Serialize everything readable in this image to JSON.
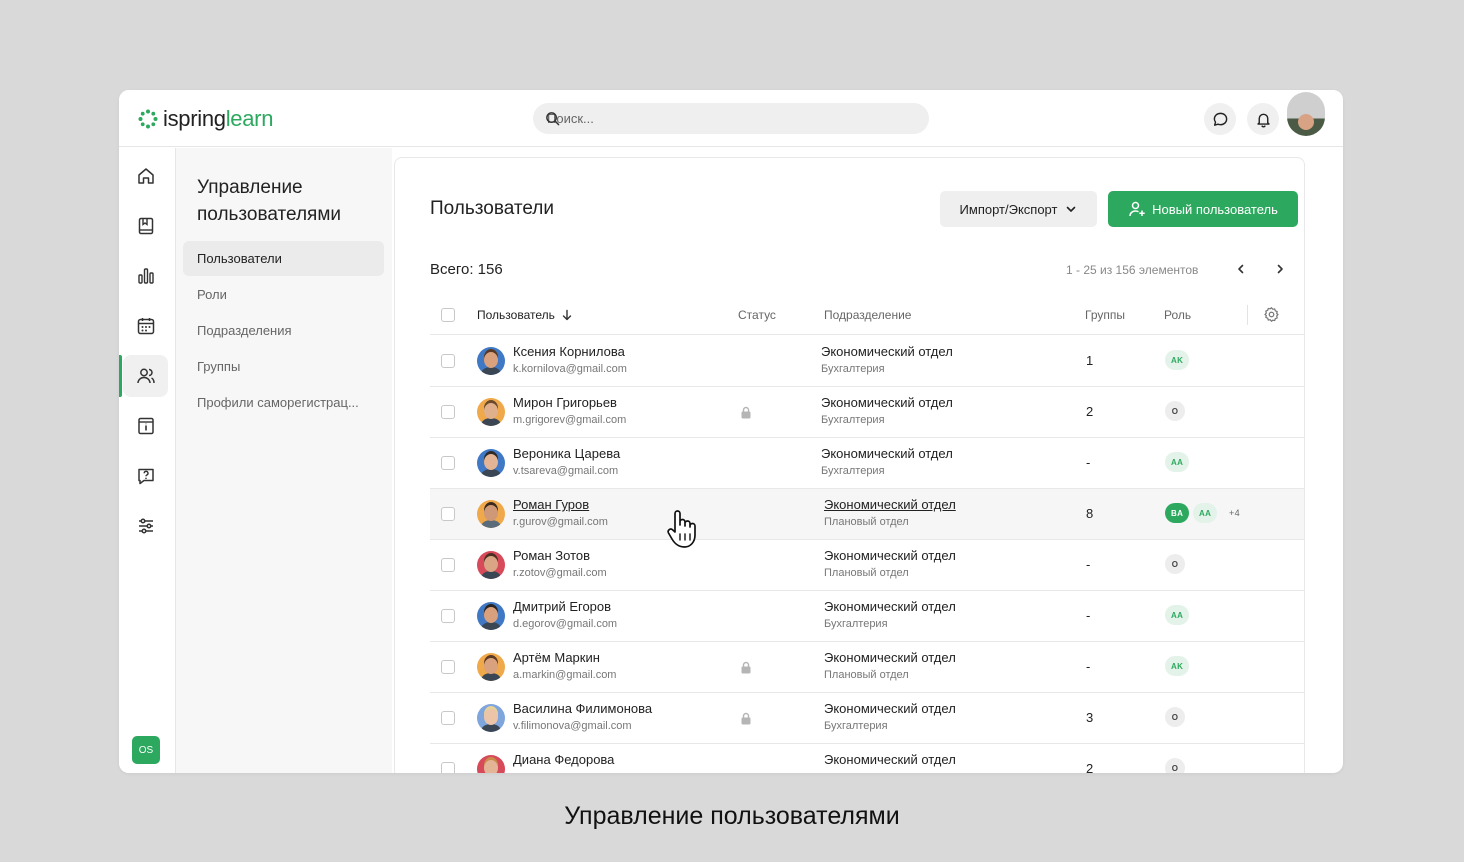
{
  "app": {
    "logo_word1": "ispring",
    "logo_word2": "learn",
    "brand_color": "#2da85f"
  },
  "search": {
    "placeholder": "Поиск..."
  },
  "topbar_icons": [
    "search-icon",
    "chat-icon",
    "bell-icon"
  ],
  "rail": {
    "items": [
      "home-icon",
      "book-icon",
      "chart-icon",
      "calendar-icon",
      "users-icon",
      "info-card-icon",
      "question-icon",
      "sliders-icon"
    ],
    "active_index": 4,
    "user_badge": "OS"
  },
  "subnav": {
    "title": "Управление пользователями",
    "items": [
      {
        "label": "Пользователи",
        "active": true
      },
      {
        "label": "Роли",
        "active": false
      },
      {
        "label": "Подразделения",
        "active": false
      },
      {
        "label": "Группы",
        "active": false
      },
      {
        "label": "Профили саморегистрац...",
        "active": false
      }
    ]
  },
  "main": {
    "title": "Пользователи",
    "import_label": "Импорт/Экспорт",
    "new_user_label": "Новый пользователь",
    "total": "Всего: 156",
    "pager": "1 - 25 из 156 элементов"
  },
  "table": {
    "columns": {
      "user": "Пользователь",
      "status": "Статус",
      "department": "Подразделение",
      "groups": "Группы",
      "role": "Роль"
    },
    "rows": [
      {
        "name": "Ксения Корнилова",
        "email": "k.kornilova@gmail.com",
        "locked": false,
        "dept": "Экономический отдел",
        "subdept": "Бухгалтерия",
        "groups": "1",
        "roles": [
          {
            "t": "AK",
            "s": "light"
          }
        ],
        "avatar_bg": "#3f78c4",
        "skin": "#d9a17e",
        "hair": "#5a3a24"
      },
      {
        "name": "Мирон Григорьев",
        "email": "m.grigorev@gmail.com",
        "locked": true,
        "dept": "Экономический отдел",
        "subdept": "Бухгалтерия",
        "groups": "2",
        "roles": [
          {
            "t": "O",
            "s": "grey"
          }
        ],
        "avatar_bg": "#f0a94a",
        "skin": "#e0b08c",
        "hair": "#6a4a2a"
      },
      {
        "name": "Вероника Царева",
        "email": "v.tsareva@gmail.com",
        "locked": false,
        "dept": "Экономический отдел",
        "subdept": "Бухгалтерия",
        "groups": "-",
        "roles": [
          {
            "t": "AA",
            "s": "light"
          }
        ],
        "avatar_bg": "#3f78c4",
        "skin": "#e3b495",
        "hair": "#2f2a26"
      },
      {
        "name": "Роман Гуров",
        "email": "r.gurov@gmail.com",
        "locked": false,
        "dept": "Экономический отдел",
        "subdept": "Плановый отдел",
        "groups": "8",
        "roles": [
          {
            "t": "BA",
            "s": "solid"
          },
          {
            "t": "AA",
            "s": "light"
          },
          {
            "t": "+4",
            "s": "more"
          }
        ],
        "avatar_bg": "#f0a94a",
        "skin": "#cf9877",
        "hair": "#3a2a1d",
        "hover": true
      },
      {
        "name": "Роман Зотов",
        "email": "r.zotov@gmail.com",
        "locked": false,
        "dept": "Экономический отдел",
        "subdept": "Плановый отдел",
        "groups": "-",
        "roles": [
          {
            "t": "O",
            "s": "grey"
          }
        ],
        "avatar_bg": "#d74a5a",
        "skin": "#d9a584",
        "hair": "#4a3020"
      },
      {
        "name": "Дмитрий Егоров",
        "email": "d.egorov@gmail.com",
        "locked": false,
        "dept": "Экономический отдел",
        "subdept": "Бухгалтерия",
        "groups": "-",
        "roles": [
          {
            "t": "AA",
            "s": "light"
          }
        ],
        "avatar_bg": "#3f78c4",
        "skin": "#d8a07c",
        "hair": "#2a2420"
      },
      {
        "name": "Артём Маркин",
        "email": "a.markin@gmail.com",
        "locked": true,
        "dept": "Экономический отдел",
        "subdept": "Плановый отдел",
        "groups": "-",
        "roles": [
          {
            "t": "AK",
            "s": "light"
          }
        ],
        "avatar_bg": "#f0a94a",
        "skin": "#d9a17e",
        "hair": "#5a3a24"
      },
      {
        "name": "Василина Филимонова",
        "email": "v.filimonova@gmail.com",
        "locked": true,
        "dept": "Экономический отдел",
        "subdept": "Бухгалтерия",
        "groups": "3",
        "roles": [
          {
            "t": "O",
            "s": "grey"
          }
        ],
        "avatar_bg": "#7fa6dc",
        "skin": "#ecc4a8",
        "hair": "#e7d09a"
      },
      {
        "name": "Диана Федорова",
        "email": "",
        "locked": false,
        "dept": "Экономический отдел",
        "subdept": "",
        "groups": "2",
        "roles": [
          {
            "t": "O",
            "s": "grey"
          }
        ],
        "avatar_bg": "#d74a5a",
        "skin": "#e3b495",
        "hair": "#c98a4a"
      }
    ]
  },
  "caption": "Управление пользователями"
}
